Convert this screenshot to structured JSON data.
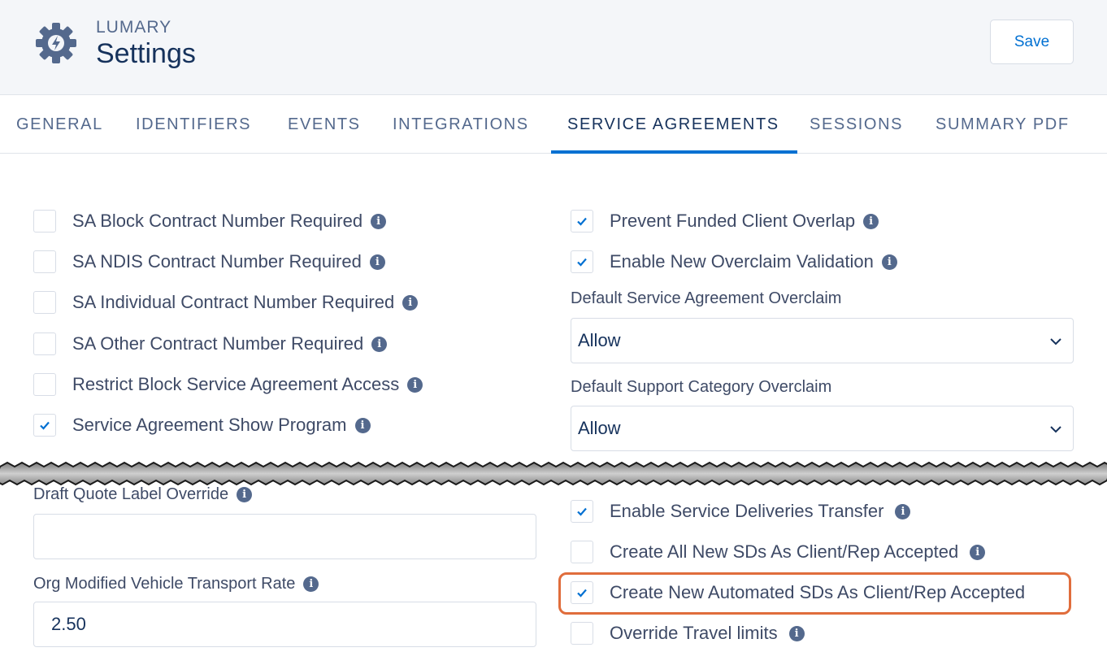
{
  "header": {
    "app_name": "LUMARY",
    "page_title": "Settings",
    "save_label": "Save"
  },
  "tabs": [
    {
      "label": "GENERAL",
      "active": false
    },
    {
      "label": "IDENTIFIERS",
      "active": false
    },
    {
      "label": "EVENTS",
      "active": false
    },
    {
      "label": "INTEGRATIONS",
      "active": false
    },
    {
      "label": "SERVICE AGREEMENTS",
      "active": true
    },
    {
      "label": "SESSIONS",
      "active": false
    },
    {
      "label": "SUMMARY PDF",
      "active": false
    }
  ],
  "left_checkboxes": [
    {
      "label": "SA Block Contract Number Required",
      "checked": false
    },
    {
      "label": "SA NDIS Contract Number Required",
      "checked": false
    },
    {
      "label": "SA Individual Contract Number Required",
      "checked": false
    },
    {
      "label": "SA Other Contract Number Required",
      "checked": false
    },
    {
      "label": "Restrict Block Service Agreement Access",
      "checked": false
    },
    {
      "label": "Service Agreement Show Program",
      "checked": true
    }
  ],
  "right_checkboxes": [
    {
      "label": "Prevent Funded Client Overlap",
      "checked": true
    },
    {
      "label": "Enable New Overclaim Validation",
      "checked": true
    }
  ],
  "selects": [
    {
      "label": "Default Service Agreement Overclaim",
      "value": "Allow"
    },
    {
      "label": "Default Support Category Overclaim",
      "value": "Allow"
    }
  ],
  "inputs": [
    {
      "label": "Draft Quote Label Override",
      "value": ""
    },
    {
      "label": "Org Modified Vehicle Transport Rate",
      "value": "2.50"
    }
  ],
  "lower_right_checkboxes": [
    {
      "label": "Enable Service Deliveries Transfer",
      "checked": true
    },
    {
      "label": "Create All New SDs As Client/Rep Accepted",
      "checked": false
    },
    {
      "label": "Create New Automated SDs As Client/Rep Accepted",
      "checked": true,
      "highlighted": true
    },
    {
      "label": "Override Travel limits",
      "checked": false
    }
  ],
  "colors": {
    "accent": "#0070d2",
    "highlight": "#e06d3c",
    "text": "#3e4a66",
    "header_bg": "#f4f6f9"
  },
  "icons": {
    "logo": "gear-lightning-icon",
    "info": "info-icon",
    "check": "check-icon",
    "chevron": "chevron-down-icon"
  }
}
